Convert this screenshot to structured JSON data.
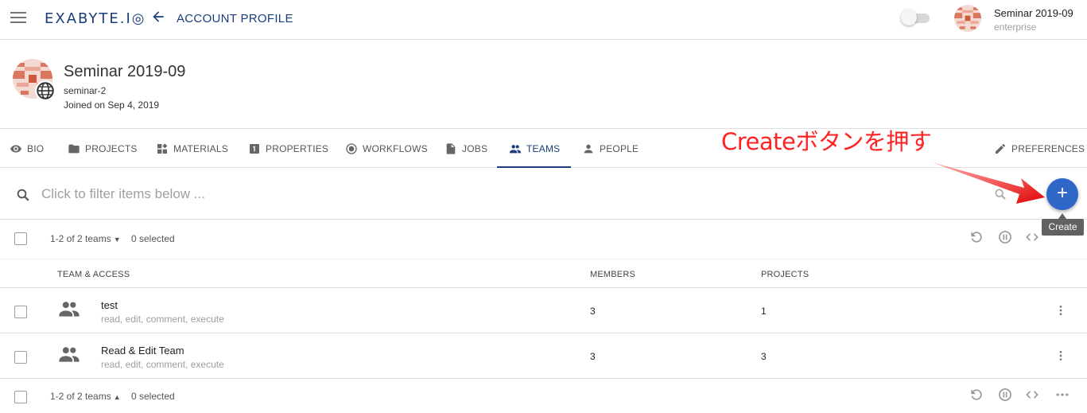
{
  "app": {
    "logo": "EXABYTE.I◎",
    "page_heading": "ACCOUNT PROFILE",
    "user_name": "Seminar 2019-09",
    "user_role": "enterprise"
  },
  "profile": {
    "name": "Seminar 2019-09",
    "handle": "seminar-2",
    "joined": "Joined on Sep 4, 2019"
  },
  "tabs": [
    {
      "label": "BIO",
      "icon": "eye-icon"
    },
    {
      "label": "PROJECTS",
      "icon": "folder-icon"
    },
    {
      "label": "MATERIALS",
      "icon": "materials-icon"
    },
    {
      "label": "PROPERTIES",
      "icon": "properties-icon"
    },
    {
      "label": "WORKFLOWS",
      "icon": "workflows-icon"
    },
    {
      "label": "JOBS",
      "icon": "file-icon"
    },
    {
      "label": "TEAMS",
      "icon": "group-icon",
      "active": true
    },
    {
      "label": "PEOPLE",
      "icon": "person-icon"
    },
    {
      "label": "PREFERENCES",
      "icon": "pencil-icon"
    }
  ],
  "annotation": "Createボタンを押す",
  "filter": {
    "placeholder": "Click to filter items below ..."
  },
  "create": {
    "label": "+",
    "tooltip": "Create"
  },
  "toolbar": {
    "count_label": "1-2 of 2 teams",
    "selected_label": "0 selected"
  },
  "table": {
    "columns": [
      "TEAM & ACCESS",
      "MEMBERS",
      "PROJECTS"
    ],
    "rows": [
      {
        "name": "test",
        "access": "read, edit, comment, execute",
        "members": "3",
        "projects": "1"
      },
      {
        "name": "Read & Edit Team",
        "access": "read, edit, comment, execute",
        "members": "3",
        "projects": "3"
      }
    ]
  },
  "colors": {
    "brand": "#1a3d7c",
    "fab": "#2f67c9",
    "annotation": "#ff2222"
  }
}
